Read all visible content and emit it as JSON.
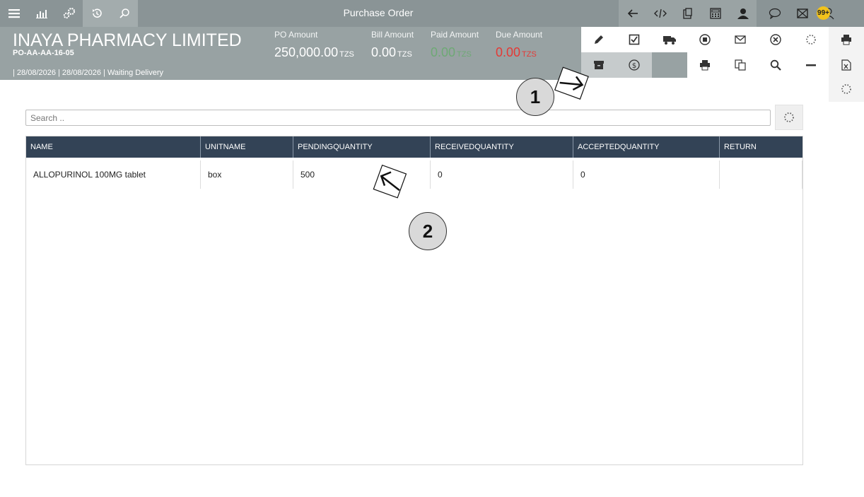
{
  "toolbar": {
    "title": "Purchase Order",
    "left_icons": [
      "menu-icon",
      "bar-chart-icon",
      "settings-gears-icon",
      "history-icon",
      "search-icon"
    ],
    "right_icons": [
      "back-arrow-icon",
      "code-icon",
      "clipboard-icon",
      "calculator-icon",
      "user-support-icon",
      "chat-icon",
      "mail-icon",
      "user-icon"
    ],
    "notification_count": "99+"
  },
  "header": {
    "company": "INAYA PHARMACY LIMITED",
    "po_code": "PO-AA-AA-16-05",
    "meta": "| 28/08/2026 | 28/08/2026 | Waiting Delivery",
    "amounts": {
      "po": {
        "label": "PO Amount",
        "value": "250,000.00",
        "currency": "TZS"
      },
      "bill": {
        "label": "Bill Amount",
        "value": "0.00",
        "currency": "TZS"
      },
      "paid": {
        "label": "Paid Amount",
        "value": "0.00",
        "currency": "TZS"
      },
      "due": {
        "label": "Due Amount",
        "value": "0.00",
        "currency": "TZS"
      }
    }
  },
  "search": {
    "placeholder": "Search .."
  },
  "table": {
    "columns": [
      "NAME",
      "UNITNAME",
      "PENDINGQUANTITY",
      "RECEIVEDQUANTITY",
      "ACCEPTEDQUANTITY",
      "RETURN"
    ],
    "rows": [
      {
        "name": "ALLOPURINOL 100MG tablet",
        "unitname": "box",
        "pending": "500",
        "received": "0",
        "accepted": "0",
        "return": ""
      }
    ]
  },
  "annotations": {
    "callout1": "1",
    "callout2": "2"
  },
  "colors": {
    "topbar": "#8a9496",
    "header": "#98a2a3",
    "table_header": "#334356",
    "due": "#e53935",
    "paid": "#4caf50",
    "badge": "#f2c21b"
  }
}
